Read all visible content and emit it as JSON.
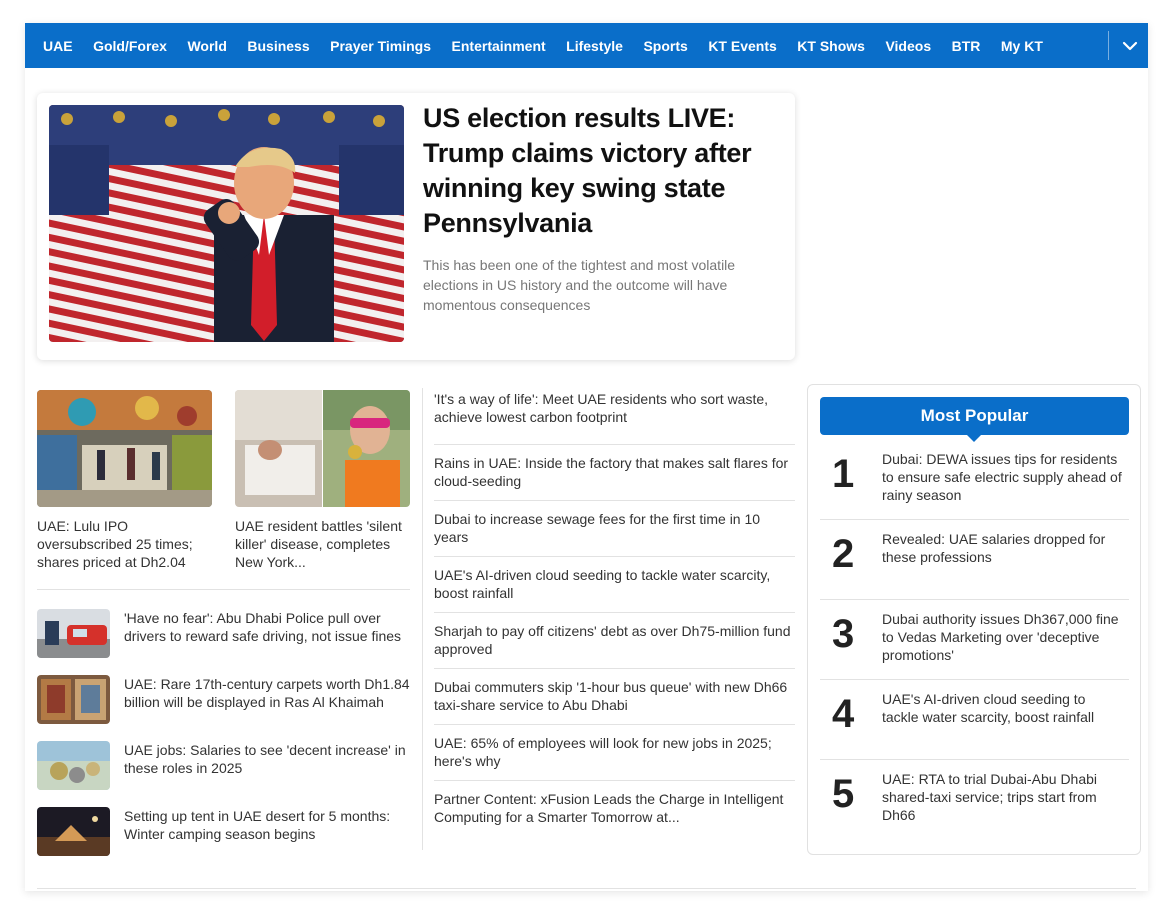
{
  "nav": {
    "items": [
      "UAE",
      "Gold/Forex",
      "World",
      "Business",
      "Prayer Timings",
      "Entertainment",
      "Lifestyle",
      "Sports",
      "KT Events",
      "KT Shows",
      "Videos",
      "BTR",
      "My KT"
    ]
  },
  "hero": {
    "title": "US election results LIVE: Trump claims victory after winning key swing state Pennsylvania",
    "summary": "This has been one of the tightest and most volatile elections in US history and the outcome will have momentous consequences"
  },
  "cards": [
    {
      "title": "UAE: Lulu IPO oversubscribed 25 times; shares priced at Dh2.04"
    },
    {
      "title": "UAE resident battles 'silent killer' disease, completes New York..."
    }
  ],
  "small_stories": [
    {
      "title": "'Have no fear': Abu Dhabi Police pull over drivers to reward safe driving, not issue fines"
    },
    {
      "title": "UAE: Rare 17th-century carpets worth Dh1.84 billion will be displayed in Ras Al Khaimah"
    },
    {
      "title": "UAE jobs: Salaries to see 'decent increase' in these roles in 2025"
    },
    {
      "title": "Setting up tent in UAE desert for 5 months: Winter camping season begins"
    }
  ],
  "headlines": [
    "'It's a way of life': Meet UAE residents who sort waste, achieve lowest carbon footprint",
    "Rains in UAE: Inside the factory that makes salt flares for cloud-seeding",
    "Dubai to increase sewage fees for the first time in 10 years",
    "UAE's AI-driven cloud seeding to tackle water scarcity, boost rainfall",
    "Sharjah to pay off citizens' debt as over Dh75-million fund approved",
    "Dubai commuters skip '1-hour bus queue' with new Dh66 taxi-share service to Abu Dhabi",
    "UAE: 65% of employees will look for new jobs in 2025; here's why",
    "Partner Content: xFusion Leads the Charge in Intelligent Computing for a Smarter Tomorrow at..."
  ],
  "popular": {
    "header": "Most Popular",
    "items": [
      {
        "num": "1",
        "title": "Dubai: DEWA issues tips for residents to ensure safe electric supply ahead of rainy season"
      },
      {
        "num": "2",
        "title": "Revealed: UAE salaries dropped for these professions"
      },
      {
        "num": "3",
        "title": "Dubai authority issues Dh367,000 fine to Vedas Marketing over 'deceptive promotions'"
      },
      {
        "num": "4",
        "title": "UAE's AI-driven cloud seeding to tackle water scarcity, boost rainfall"
      },
      {
        "num": "5",
        "title": "UAE: RTA to trial Dubai-Abu Dhabi shared-taxi service; trips start from Dh66"
      }
    ]
  },
  "colors": {
    "brand": "#0a6ec9"
  },
  "icons": {
    "nav_more": "chevron-down-icon"
  }
}
